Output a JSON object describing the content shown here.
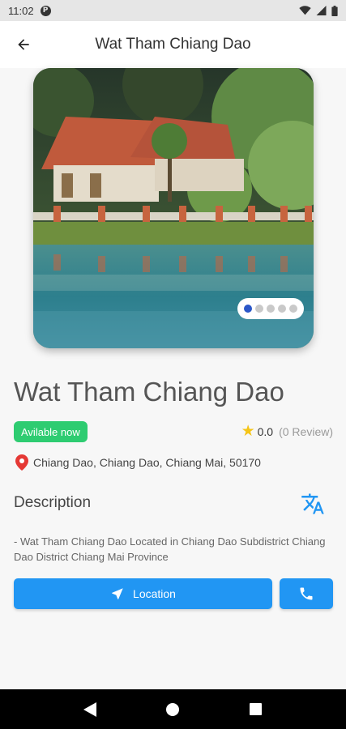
{
  "status_bar": {
    "time": "11:02",
    "notification_icon": "p-icon",
    "icons": [
      "wifi-icon",
      "signal-icon",
      "battery-icon"
    ]
  },
  "app_bar": {
    "title": "Wat Tham Chiang Dao",
    "back_icon": "arrow-back-icon"
  },
  "gallery": {
    "image_subject": "temple-by-lake",
    "total_images": 5,
    "active_index": 0
  },
  "place": {
    "name": "Wat Tham Chiang Dao",
    "availability": "Avilable now",
    "rating": "0.0",
    "reviews": "(0 Review)",
    "address": "Chiang Dao, Chiang Dao, Chiang Mai, 50170"
  },
  "description": {
    "heading": "Description",
    "text": "- Wat Tham Chiang Dao Located in Chiang Dao Subdistrict Chiang Dao District Chiang Mai Province",
    "translate_icon": "translate-icon"
  },
  "actions": {
    "location_label": "Location",
    "call_icon": "phone-icon"
  },
  "colors": {
    "accent_blue": "#2196f3",
    "badge_green": "#2ecc71",
    "pin_red": "#e53935",
    "star_yellow": "#f5c518"
  }
}
